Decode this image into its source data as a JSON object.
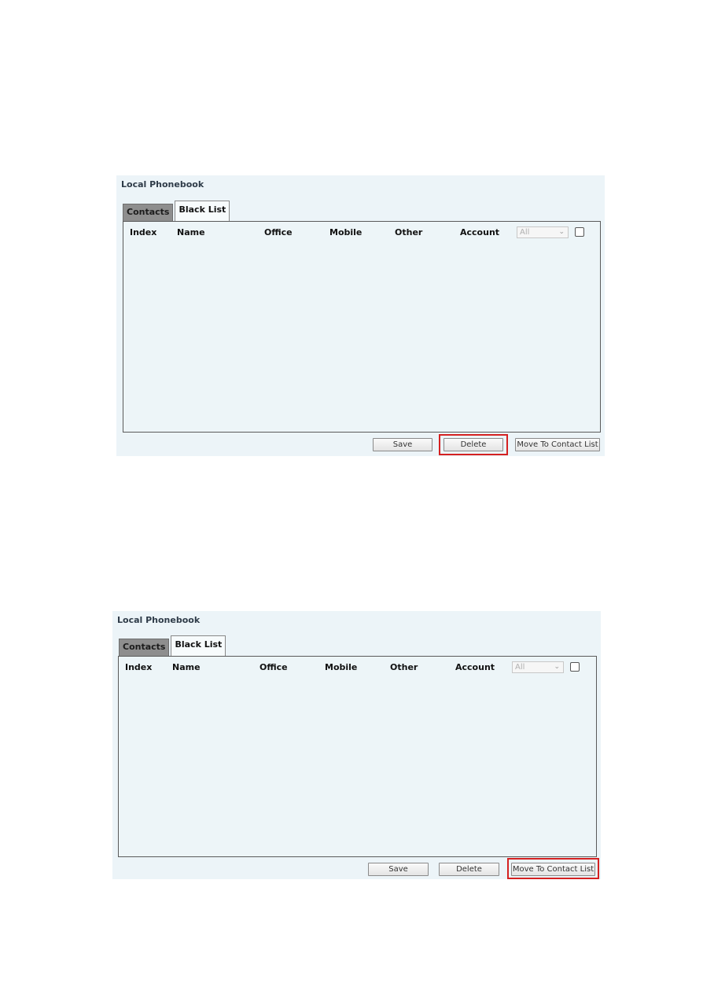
{
  "panels": [
    {
      "title": "Local Phonebook",
      "tabs": [
        {
          "label": "Contacts",
          "active": false
        },
        {
          "label": "Black List",
          "active": true
        }
      ],
      "columns": [
        "Index",
        "Name",
        "Office",
        "Mobile",
        "Other",
        "Account"
      ],
      "account_filter": {
        "selected": "All"
      },
      "select_all_checked": false,
      "rows": [],
      "buttons": {
        "save": "Save",
        "delete": "Delete",
        "move": "Move To Contact List"
      },
      "highlighted_button": "delete"
    },
    {
      "title": "Local Phonebook",
      "tabs": [
        {
          "label": "Contacts",
          "active": false
        },
        {
          "label": "Black List",
          "active": true
        }
      ],
      "columns": [
        "Index",
        "Name",
        "Office",
        "Mobile",
        "Other",
        "Account"
      ],
      "account_filter": {
        "selected": "All"
      },
      "select_all_checked": false,
      "rows": [],
      "buttons": {
        "save": "Save",
        "delete": "Delete",
        "move": "Move To Contact List"
      },
      "highlighted_button": "move"
    }
  ],
  "icons": {
    "dropdown": "chevron-down-icon",
    "checkbox": "checkbox-icon"
  },
  "colors": {
    "highlight": "#d42121",
    "panel_bg": "#ecf4f8",
    "inactive_tab": "#8e8e8e"
  }
}
